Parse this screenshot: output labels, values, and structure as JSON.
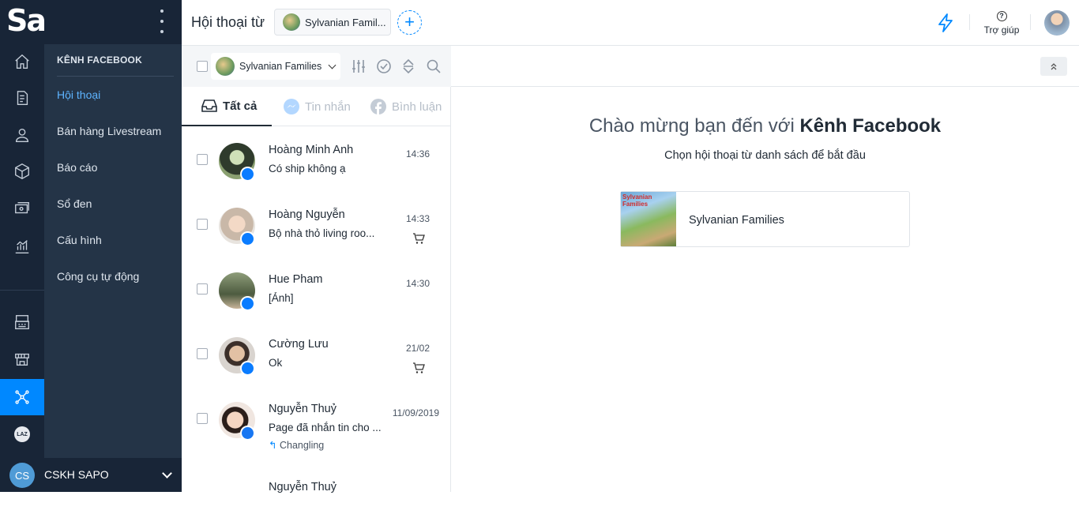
{
  "app": {
    "logo": "Sapo"
  },
  "sidebar": {
    "section_title": "KÊNH FACEBOOK",
    "items": [
      {
        "label": "Hội thoại",
        "active": true
      },
      {
        "label": "Bán hàng Livestream"
      },
      {
        "label": "Báo cáo"
      },
      {
        "label": "Sổ đen"
      },
      {
        "label": "Cấu hình"
      },
      {
        "label": "Công cụ tự động"
      }
    ],
    "rail_icons": [
      "home-icon",
      "order-icon",
      "customer-icon",
      "product-icon",
      "cashbook-icon",
      "report-icon",
      "pos-icon",
      "store-icon",
      "social-channel-icon",
      "lazada-icon"
    ],
    "lazada_badge": "LAZ"
  },
  "account": {
    "initials": "CS",
    "name": "CSKH SAPO"
  },
  "header": {
    "title": "Hội thoại từ",
    "page_chip": "Sylvanian Famil...",
    "add_label": "+",
    "help_label": "Trợ giúp"
  },
  "list": {
    "page_select": "Sylvanian Families",
    "tabs": [
      {
        "label": "Tất cả",
        "active": true
      },
      {
        "label": "Tin nhắn"
      },
      {
        "label": "Bình luận"
      }
    ],
    "conversations": [
      {
        "name": "Hoàng Minh Anh",
        "message": "Có ship không ạ",
        "time": "14:36",
        "source": "messenger",
        "cart": false
      },
      {
        "name": "Hoàng Nguyễn",
        "message": "Bộ nhà thỏ living roo...",
        "time": "14:33",
        "source": "messenger",
        "cart": true
      },
      {
        "name": "Hue Pham",
        "message": "[Ảnh]",
        "time": "14:30",
        "source": "messenger",
        "cart": false
      },
      {
        "name": "Cường Lưu",
        "message": "Ok",
        "time": "21/02",
        "source": "messenger",
        "cart": true
      },
      {
        "name": "Nguyễn Thuỷ",
        "message": "Page đã nhắn tin cho ...",
        "time": "11/09/2019",
        "source": "facebook",
        "cart": false,
        "reply": "Changling"
      },
      {
        "name": "Nguyễn Thuỷ",
        "message": "",
        "time": "",
        "source": "facebook",
        "cart": false
      }
    ]
  },
  "main": {
    "welcome_prefix": "Chào mừng bạn đến với ",
    "welcome_brand": "Kênh Facebook",
    "subtitle": "Chọn hội thoại từ danh sách để bắt đầu",
    "page_name": "Sylvanian Families",
    "thumb_text": "Sylvanian Families"
  },
  "colors": {
    "accent": "#0088ff",
    "rail": "#182537",
    "menu": "#243447",
    "messenger": "#0a7cff",
    "facebook": "#1877f2"
  }
}
